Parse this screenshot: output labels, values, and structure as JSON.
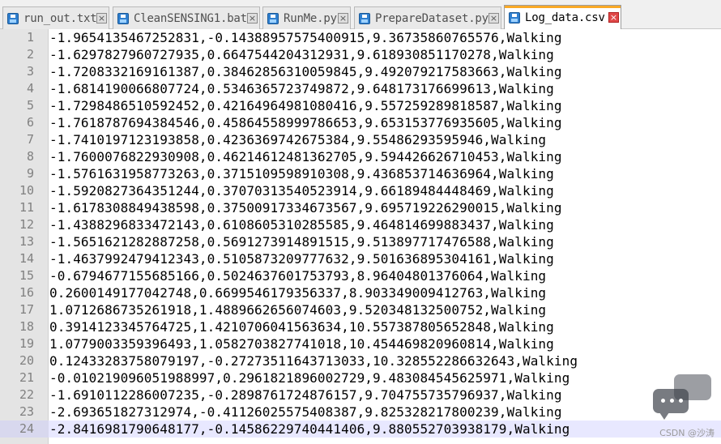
{
  "tabs": [
    {
      "label": "run_out.txt",
      "active": false
    },
    {
      "label": "CleanSENSING1.bat",
      "active": false
    },
    {
      "label": "RunMe.py",
      "active": false
    },
    {
      "label": "PrepareDataset.py",
      "active": false
    },
    {
      "label": "Log_data.csv",
      "active": true
    }
  ],
  "editor": {
    "current_line": 24,
    "lines": [
      {
        "n": "1",
        "text": "-1.9654135467252831,-0.14388957575400915,9.36735860765576,Walking"
      },
      {
        "n": "2",
        "text": "-1.6297827960727935,0.6647544204312931,9.618930851170278,Walking"
      },
      {
        "n": "3",
        "text": "-1.7208332169161387,0.38462856310059845,9.492079217583663,Walking"
      },
      {
        "n": "4",
        "text": "-1.6814190066807724,0.5346365723749872,9.648173176699613,Walking"
      },
      {
        "n": "5",
        "text": "-1.7298486510592452,0.42164964981080416,9.557259289818587,Walking"
      },
      {
        "n": "6",
        "text": "-1.7618787694384546,0.45864558999786653,9.653153776935605,Walking"
      },
      {
        "n": "7",
        "text": "-1.7410197123193858,0.4236369742675384,9.55486293595946,Walking"
      },
      {
        "n": "8",
        "text": "-1.7600076822930908,0.46214612481362705,9.594426626710453,Walking"
      },
      {
        "n": "9",
        "text": "-1.5761631958773263,0.3715109598910308,9.436853714636964,Walking"
      },
      {
        "n": "10",
        "text": "-1.5920827364351244,0.37070313540523914,9.66189484448469,Walking"
      },
      {
        "n": "11",
        "text": "-1.6178308849438598,0.37500917334673567,9.695719226290015,Walking"
      },
      {
        "n": "12",
        "text": "-1.4388296833472143,0.6108605310285585,9.464814699883437,Walking"
      },
      {
        "n": "13",
        "text": "-1.5651621282887258,0.5691273914891515,9.513897717476588,Walking"
      },
      {
        "n": "14",
        "text": "-1.4637992479412343,0.5105873209777632,9.501636895304161,Walking"
      },
      {
        "n": "15",
        "text": "-0.6794677155685166,0.5024637601753793,8.96404801376064,Walking"
      },
      {
        "n": "16",
        "text": "0.2600149177042748,0.6699546179356337,8.903349009412763,Walking"
      },
      {
        "n": "17",
        "text": "1.0712686735261918,1.4889662656074603,9.520348132500752,Walking"
      },
      {
        "n": "18",
        "text": "0.3914123345764725,1.4210706041563634,10.557387805652848,Walking"
      },
      {
        "n": "19",
        "text": "1.0779003359396493,1.0582703827741018,10.454469820960814,Walking"
      },
      {
        "n": "20",
        "text": "0.12433283758079197,-0.27273511643713033,10.328552286632643,Walking"
      },
      {
        "n": "21",
        "text": "-0.010219096051988997,0.2961821896002729,9.483084545625971,Walking"
      },
      {
        "n": "22",
        "text": "-1.6910112286007235,-0.2898761724876157,9.704755735796937,Walking"
      },
      {
        "n": "23",
        "text": "-2.693651827312974,-0.41126025575408387,9.825328217800239,Walking"
      },
      {
        "n": "24",
        "text": "-2.8416981790648177,-0.14586229740441406,9.880552703938179,Walking"
      }
    ]
  },
  "watermark": {
    "text": "CSDN @沙涛"
  }
}
